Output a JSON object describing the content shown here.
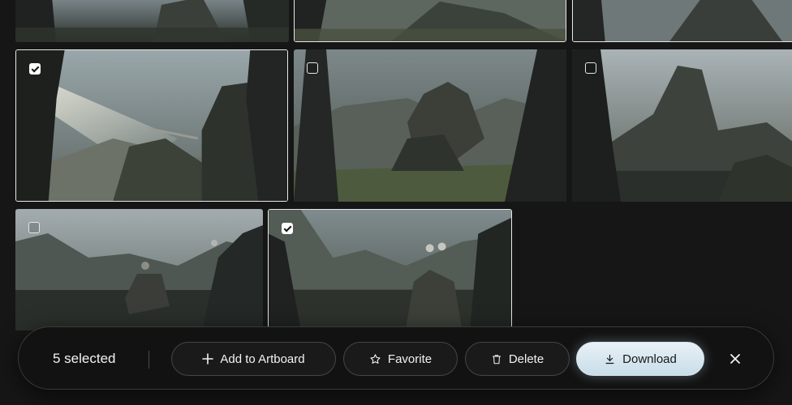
{
  "gallery": {
    "tiles": [
      {
        "name": "tile-top-1",
        "selected": false,
        "show_checkbox": false
      },
      {
        "name": "tile-top-2",
        "selected": true,
        "show_checkbox": false
      },
      {
        "name": "tile-top-3",
        "selected": true,
        "show_checkbox": false
      },
      {
        "name": "tile-row2-1",
        "selected": true,
        "show_checkbox": true
      },
      {
        "name": "tile-row2-2",
        "selected": false,
        "show_checkbox": true
      },
      {
        "name": "tile-row2-3",
        "selected": false,
        "show_checkbox": true
      },
      {
        "name": "tile-row3-1",
        "selected": false,
        "show_checkbox": true
      },
      {
        "name": "tile-row3-2",
        "selected": true,
        "show_checkbox": true
      }
    ]
  },
  "toolbar": {
    "selected_count_label": "5 selected",
    "add_to_artboard_label": "Add to Artboard",
    "favorite_label": "Favorite",
    "delete_label": "Delete",
    "download_label": "Download",
    "icons": {
      "add": "plus-icon",
      "favorite": "star-icon",
      "delete": "trash-icon",
      "download": "download-icon",
      "close": "close-icon"
    },
    "colors": {
      "primary_button": "#d6e7f0",
      "toolbar_bg": "#121212"
    }
  }
}
